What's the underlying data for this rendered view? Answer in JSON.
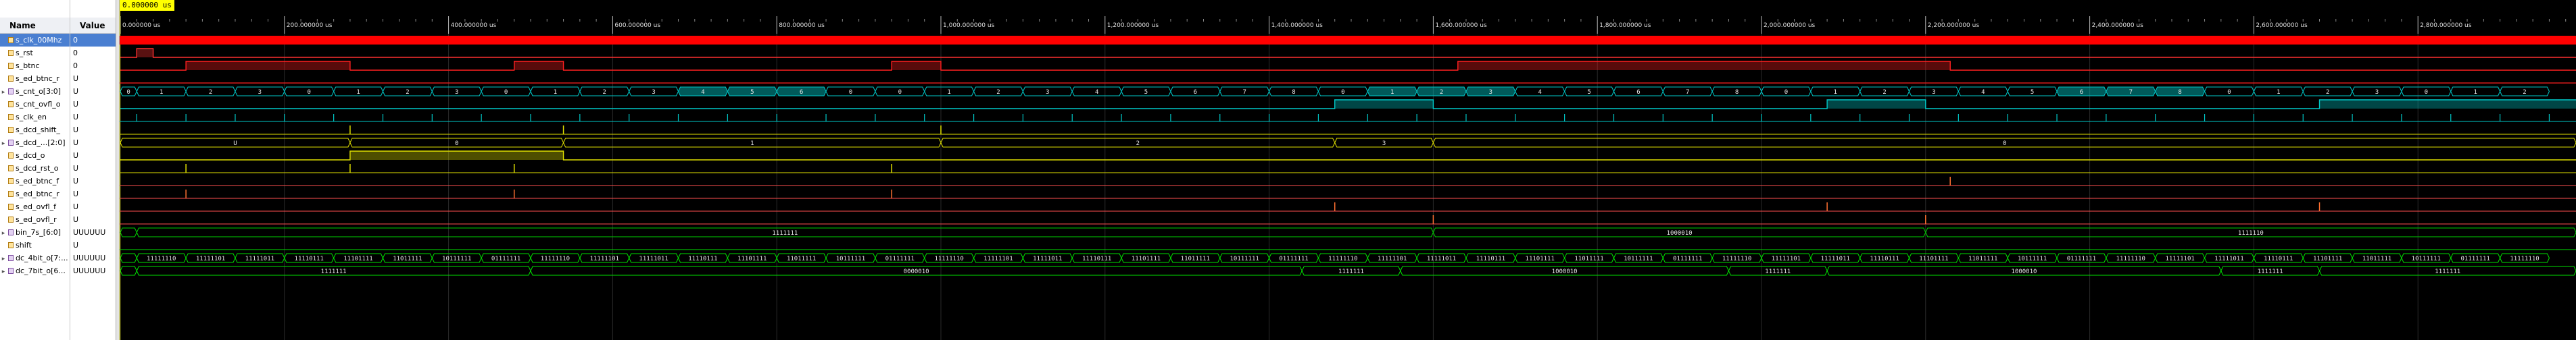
{
  "panel": {
    "name_header": "Name",
    "value_header": "Value"
  },
  "cursor_time": "0.000000 us",
  "signals": [
    {
      "name": "s_clk_00Mhz",
      "value": "0",
      "type": "bit",
      "selected": true
    },
    {
      "name": "s_rst",
      "value": "0",
      "type": "bit"
    },
    {
      "name": "s_btnc",
      "value": "0",
      "type": "bit"
    },
    {
      "name": "s_ed_btnc_r",
      "value": "U",
      "type": "bit"
    },
    {
      "name": "s_cnt_o[3:0]",
      "value": "U",
      "type": "bus"
    },
    {
      "name": "s_cnt_ovfl_o",
      "value": "U",
      "type": "bit"
    },
    {
      "name": "s_clk_en",
      "value": "U",
      "type": "bit"
    },
    {
      "name": "s_dcd_shift_",
      "value": "U",
      "type": "bit"
    },
    {
      "name": "s_dcd_...[2:0]",
      "value": "U",
      "type": "bus"
    },
    {
      "name": "s_dcd_o",
      "value": "U",
      "type": "bit"
    },
    {
      "name": "s_dcd_rst_o",
      "value": "U",
      "type": "bit"
    },
    {
      "name": "s_ed_btnc_f",
      "value": "U",
      "type": "bit"
    },
    {
      "name": "s_ed_btnc_r",
      "value": "U",
      "type": "bit"
    },
    {
      "name": "s_ed_ovfl_f",
      "value": "U",
      "type": "bit"
    },
    {
      "name": "s_ed_ovfl_r",
      "value": "U",
      "type": "bit"
    },
    {
      "name": "bin_7s_[6:0]",
      "value": "UUUUUU",
      "type": "bus"
    },
    {
      "name": "shift",
      "value": "U",
      "type": "bit"
    },
    {
      "name": "dc_4bit_o[7:...",
      "value": "UUUUUU",
      "type": "bus"
    },
    {
      "name": "dc_7bit_o[6...",
      "value": "UUUUUU",
      "type": "bus"
    }
  ],
  "timeline": {
    "ticks": [
      "0.000000 us",
      "200.000000 us",
      "400.000000 us",
      "600.000000 us",
      "800.000000 us",
      "1,000.000000 us",
      "1,200.000000 us",
      "1,400.000000 us",
      "1,600.000000 us",
      "1,800.000000 us",
      "2,000.000000 us",
      "2,200.000000 us",
      "2,400.000000 us",
      "2,600.000000 us",
      "2,800.000000 us",
      "3,000.000000 us",
      "3,200.000000 us",
      "3,400.000000 us",
      "3,600.000000 us",
      "3,800.000000 us",
      "4,000.000000 us",
      "4,200.000000 us",
      "4,400.000000 us",
      "4,600.000000 us",
      "4,800.000000 us",
      "5,000.000000 us",
      "5,200.000000 us",
      "5,400.000000 us",
      "5,600.000000 us",
      "5,800.000000 us",
      "6,000.000000 us",
      "6,200.000000 us",
      "6,400.000000 us",
      "6,600.000000 us",
      "6,800.000000 us",
      "7,000.000000 us",
      "7,200.000000 us",
      "7,400.000000 us",
      "7,600.000000 us",
      "7,800.000000 us",
      "8,000.000000 us",
      "8,200.000000 us",
      "8,400.000000 us",
      "8,600.000000 us",
      "8,800.000000 us",
      "9,000.000000 us",
      "9,200.000000 us",
      "9,400.000000 us",
      "9,600.000000 us",
      "9,800.000000 us",
      "10,000.000000 us",
      "10,200.000000 us",
      "10,400.000000 us",
      "10,600.000000 us",
      "10,800.000000 us",
      "11,000.000000 us",
      "11,200.000000 us",
      "11,400.000000 us",
      "11,600.000000 us",
      "11,800.000000 us",
      "12,000.000000 us",
      "12,200.000000 us",
      "12,400.000000 us",
      "12,600.000000 us",
      "12,800.000000 us",
      "13,000.000000 us",
      "13,200.000000 us",
      "13,400.000000 us",
      "13,600.000000 us",
      "13,800.000000 us",
      "14,000.000000 us",
      "14,200.000000 us",
      "14,400.000000 us",
      "14,600.000000 us",
      "14,800.000000 us"
    ]
  },
  "bus_labels": {
    "cnt": [
      "0",
      "1",
      "2",
      "3",
      "0",
      "1",
      "2",
      "3",
      "0",
      "1",
      "2",
      "3",
      "4",
      "5",
      "6",
      "0",
      "0",
      "1",
      "2",
      "3",
      "4",
      "5",
      "6",
      "7",
      "8",
      "0",
      "1",
      "2",
      "3",
      "4",
      "5",
      "6",
      "7",
      "8",
      "0",
      "1",
      "2",
      "3",
      "4",
      "5",
      "6",
      "7",
      "8"
    ],
    "dcd": [
      "U",
      "0",
      "1",
      "2",
      "3",
      "0"
    ],
    "bin7": [
      "1111111",
      "1000010",
      "1111110"
    ],
    "dc4": [
      "11111110",
      "11111101",
      "11111011",
      "11110111",
      "11101111",
      "11011111",
      "10111111",
      "01111111",
      "11111110",
      "11111101",
      "11111011",
      "11110111",
      "11101111",
      "11011111",
      "10111111",
      "01111111",
      "11111110",
      "11111101",
      "11111011",
      "11110111",
      "11101111",
      "11011111",
      "10111111",
      "01111111",
      "11111110",
      "11111101",
      "11111011",
      "11110111",
      "11101111",
      "11011111",
      "10111111",
      "01111111",
      "11111110",
      "11111101",
      "11111011",
      "11110111",
      "11101111",
      "11011111",
      "10111111",
      "01111111",
      "11111110",
      "11111101",
      "11111011",
      "11110111",
      "11101111",
      "11011111",
      "10111111",
      "01111111",
      "11111110",
      "11111101",
      "11111011",
      "11110111",
      "11101111",
      "11011111",
      "10111111",
      "01111111"
    ],
    "dc7": [
      "1111111",
      "0000010",
      "1111111",
      "1000010",
      "1111111",
      "1000010",
      "1111111",
      "1111111",
      "1111110"
    ]
  },
  "colors": {
    "clk": "#ff0000",
    "bit": "#00e000",
    "bus": "#00c8c8",
    "dcd": "#e0e000",
    "grid": "#2a2a2a",
    "bin7": "#00d000"
  }
}
